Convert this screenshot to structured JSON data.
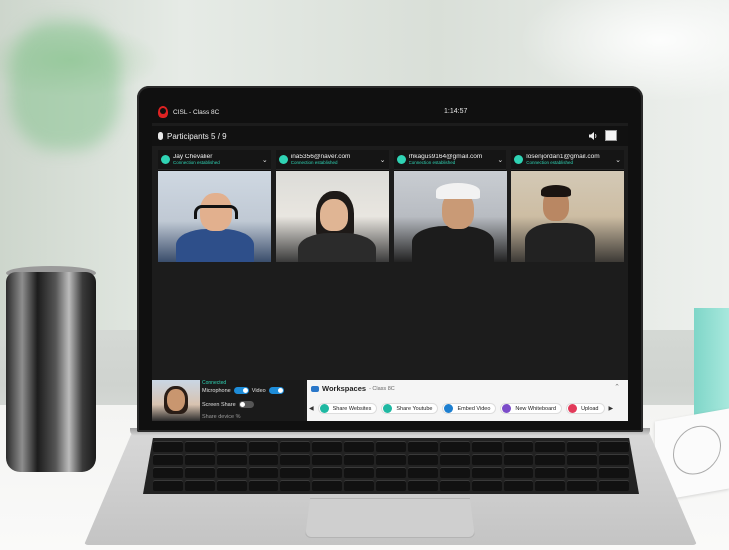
{
  "window": {
    "title": "CISL - Class 8C",
    "clock": "1:14:57"
  },
  "participants": {
    "header": "Participants 5 / 9",
    "tiles": [
      {
        "name": "Jay Chevalier",
        "status": "Connection established"
      },
      {
        "name": "ina5356@naver.com",
        "status": "Connection established"
      },
      {
        "name": "rhkagus9164@gmail.com",
        "status": "Connection established"
      },
      {
        "name": "losenjordan1@gmail.com",
        "status": "Connection established"
      }
    ]
  },
  "self_controls": {
    "status": "Connected",
    "microphone_label": "Microphone",
    "video_label": "Video",
    "screen_share_label": "Screen Share",
    "share_device_label": "Share device %"
  },
  "workspaces": {
    "title": "Workspaces",
    "subtitle": "- Class 8C",
    "tools": [
      {
        "label": "Share Websites",
        "color": "#1fb8a2"
      },
      {
        "label": "Share Youtube",
        "color": "#1fb8a2"
      },
      {
        "label": "Embed Video",
        "color": "#1d7fd0"
      },
      {
        "label": "New Whiteboard",
        "color": "#7b4cc9"
      },
      {
        "label": "Upload",
        "color": "#e23a5a"
      }
    ]
  },
  "icons": {
    "app_logo": "cisl-logo-icon",
    "mic": "microphone-icon",
    "speaker": "speaker-icon",
    "layout": "grid-layout-icon"
  }
}
